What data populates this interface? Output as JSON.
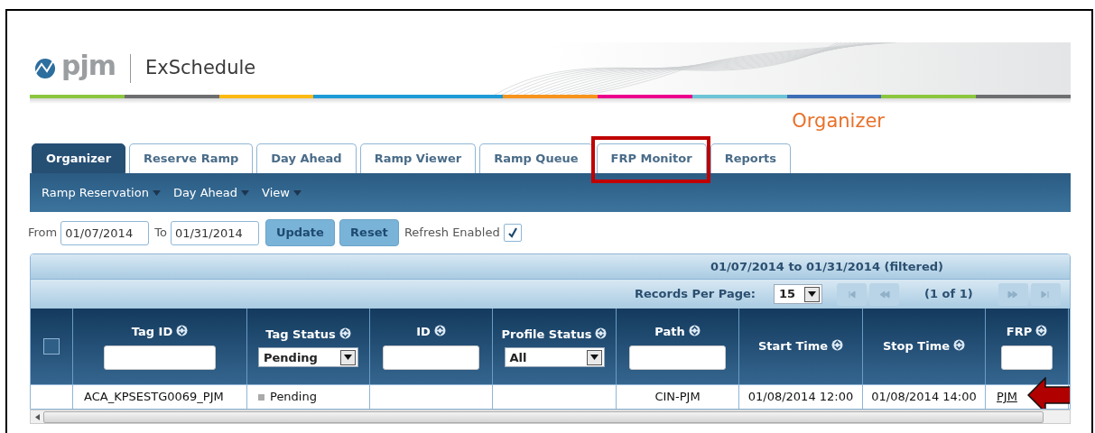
{
  "header": {
    "logo_text": "pjm",
    "app_name": "ExSchedule"
  },
  "page_title": "Organizer",
  "tabs": [
    {
      "label": "Organizer",
      "selected": true
    },
    {
      "label": "Reserve Ramp",
      "selected": false
    },
    {
      "label": "Day Ahead",
      "selected": false
    },
    {
      "label": "Ramp Viewer",
      "selected": false
    },
    {
      "label": "Ramp Queue",
      "selected": false
    },
    {
      "label": "FRP Monitor",
      "selected": false,
      "highlighted": true
    },
    {
      "label": "Reports",
      "selected": false
    }
  ],
  "menu": [
    "Ramp Reservation",
    "Day Ahead",
    "View"
  ],
  "filter": {
    "from_label": "From",
    "from_value": "01/07/2014",
    "to_label": "To",
    "to_value": "01/31/2014",
    "update": "Update",
    "reset": "Reset",
    "refresh_label": "Refresh Enabled",
    "refresh_checked": true
  },
  "table": {
    "caption": "01/07/2014 to 01/31/2014 (filtered)",
    "pager": {
      "records_label": "Records Per Page:",
      "records_value": "15",
      "page_text": "(1 of 1)",
      "buttons": [
        {
          "kind": "first",
          "disabled": true
        },
        {
          "kind": "prev",
          "disabled": true
        },
        {
          "kind": "next",
          "disabled": true
        },
        {
          "kind": "last",
          "disabled": true
        }
      ]
    },
    "select_all_checked": false,
    "columns": [
      {
        "label": "Tag ID",
        "filter": {
          "kind": "text"
        }
      },
      {
        "label": "Tag Status",
        "filter": {
          "kind": "select",
          "value": "Pending"
        }
      },
      {
        "label": "ID",
        "filter": {
          "kind": "text"
        }
      },
      {
        "label": "Profile Status",
        "filter": {
          "kind": "select",
          "value": "All"
        }
      },
      {
        "label": "Path",
        "filter": {
          "kind": "text"
        }
      },
      {
        "label": "Start Time",
        "filter": {
          "kind": "none"
        }
      },
      {
        "label": "Stop Time",
        "filter": {
          "kind": "none"
        }
      },
      {
        "label": "FRP",
        "filter": {
          "kind": "text"
        }
      }
    ],
    "rows": [
      {
        "cells": [
          {
            "kind": "text",
            "text": "ACA_KPSESTG0069_PJM"
          },
          {
            "kind": "status",
            "text": "Pending"
          },
          {
            "kind": "empty"
          },
          {
            "kind": "empty"
          },
          {
            "kind": "text",
            "text": "CIN-PJM"
          },
          {
            "kind": "text",
            "text": "01/08/2014 12:00"
          },
          {
            "kind": "text",
            "text": "01/08/2014 14:00"
          },
          {
            "kind": "link",
            "text": "PJM",
            "pointed": true
          }
        ]
      }
    ]
  }
}
